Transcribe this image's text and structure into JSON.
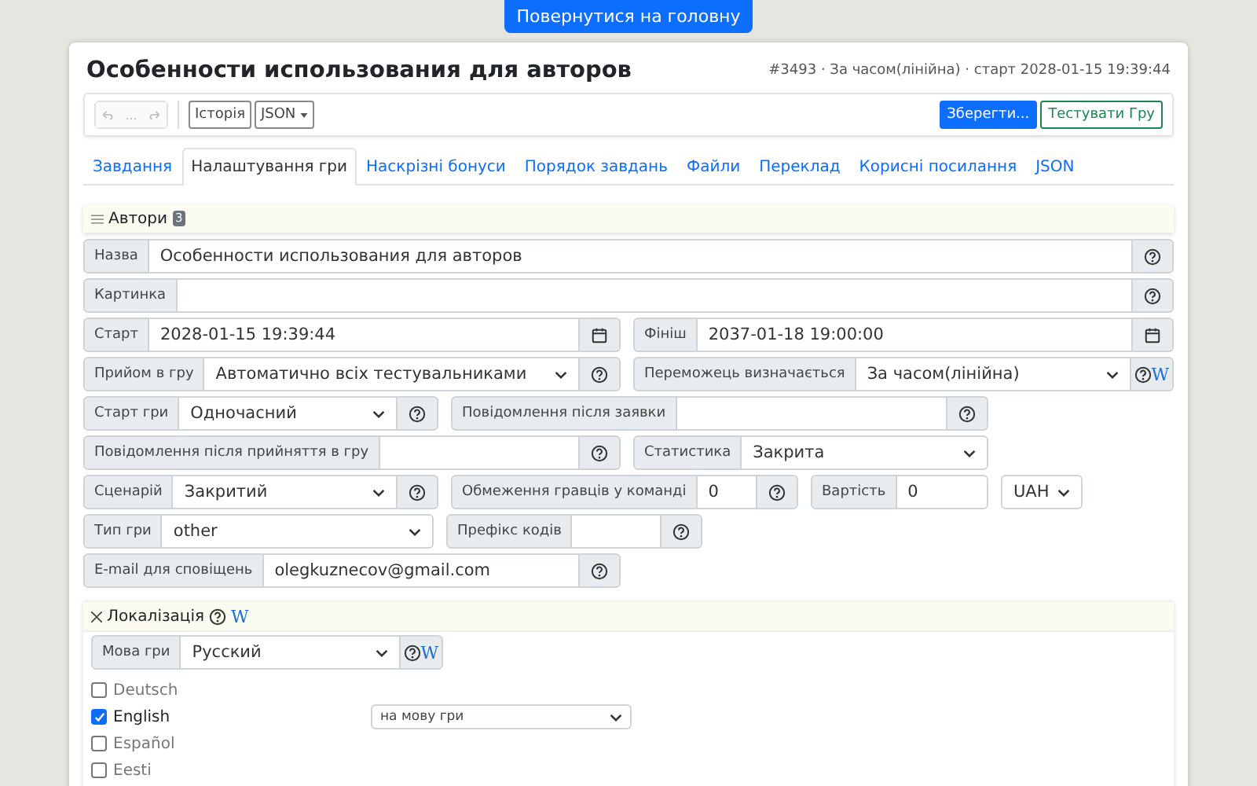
{
  "home_button": "Повернутися на головну",
  "title": "Особенности использования для авторов",
  "meta": "#3493 · За часом(лінійна) · старт 2028-01-15 19:39:44",
  "toolbar": {
    "history_menu": "...",
    "history": "Історія",
    "json": "JSON",
    "save": "Зберегти...",
    "test": "Тестувати Гру"
  },
  "tabs": [
    {
      "label": "Завдання",
      "selected": false
    },
    {
      "label": "Налаштування гри",
      "selected": true
    },
    {
      "label": "Наскрізні бонуси",
      "selected": false
    },
    {
      "label": "Порядок завдань",
      "selected": false
    },
    {
      "label": "Файли",
      "selected": false
    },
    {
      "label": "Переклад",
      "selected": false
    },
    {
      "label": "Корисні посилання",
      "selected": false
    },
    {
      "label": "JSON",
      "selected": false
    }
  ],
  "authors": {
    "title": "Автори",
    "count": "3"
  },
  "form_rows": [
    [
      {
        "kind": "input",
        "label": "Назва",
        "value": "Особенности использования для авторов",
        "help": true
      }
    ],
    [
      {
        "kind": "input",
        "label": "Картинка",
        "help": true
      }
    ],
    [
      {
        "kind": "date",
        "label": "Старт",
        "value": "2028-01-15 19:39:44"
      },
      {
        "kind": "date",
        "label": "Фініш",
        "value": "2037-01-18 19:00:00"
      }
    ],
    [
      {
        "kind": "select",
        "label": "Прийом в гру",
        "value": "Автоматично всіх тестувальниками",
        "help": true
      },
      {
        "kind": "select",
        "label": "Переможець визначається",
        "value": "За часом(лінійна)",
        "help": true,
        "wiki": "W"
      }
    ],
    [
      {
        "kind": "select",
        "label": "Старт гри",
        "value": "Одночасний",
        "help": true
      },
      {
        "kind": "input",
        "label": "Повідомлення після заявки",
        "help": true
      }
    ],
    [
      {
        "kind": "input",
        "label": "Повідомлення після прийняття в гру",
        "help": true
      },
      {
        "kind": "select",
        "label": "Статистика",
        "value": "Закрита",
        "help": false
      }
    ],
    [
      {
        "kind": "select",
        "label": "Сценарій",
        "value": "Закритий",
        "help": true
      },
      {
        "kind": "input",
        "label": "Обмеження гравців у команді",
        "value": "0",
        "help": true
      },
      {
        "kind": "input",
        "label": "Вартість",
        "value": "0",
        "help": false
      },
      {
        "kind": "select",
        "value": "UAH",
        "help": false
      }
    ],
    [
      {
        "kind": "select",
        "label": "Тип гри",
        "value": "other",
        "help": false
      },
      {
        "kind": "input",
        "label": "Префікс кодів",
        "help": true
      }
    ],
    [
      {
        "kind": "input",
        "label": "E-mail для сповіщень",
        "value": "olegkuznecov@gmail.com",
        "help": true
      }
    ]
  ],
  "localization": {
    "title": "Локалізація",
    "wiki": "W",
    "language_label": "Мова гри",
    "language": "Русский",
    "language_wiki": "W",
    "languages": [
      {
        "name": "Deutsch",
        "checked": false
      },
      {
        "name": "English",
        "checked": true,
        "mode": "на мову гри"
      },
      {
        "name": "Español",
        "checked": false
      },
      {
        "name": "Eesti",
        "checked": false
      }
    ]
  }
}
